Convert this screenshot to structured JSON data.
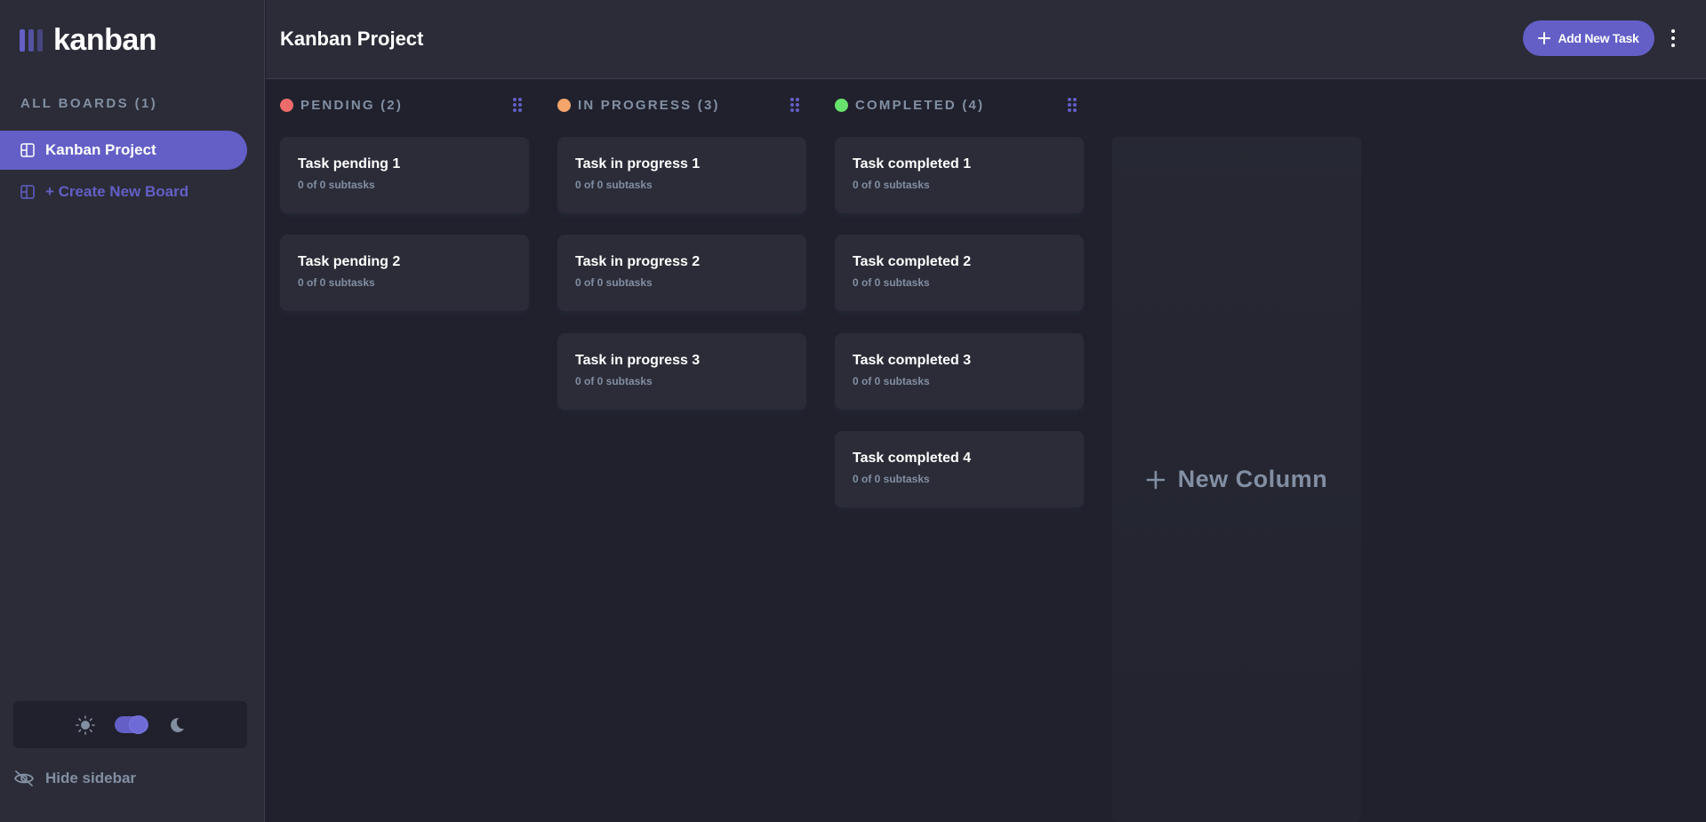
{
  "app": {
    "logo_text": "kanban"
  },
  "sidebar": {
    "all_boards_label": "ALL BOARDS (1)",
    "boards": [
      {
        "label": "Kanban Project",
        "active": true
      }
    ],
    "create_board_label": "+ Create New Board",
    "hide_sidebar_label": "Hide sidebar",
    "theme": "dark"
  },
  "header": {
    "title": "Kanban Project",
    "add_task_label": "Add New Task"
  },
  "columns": [
    {
      "title": "PENDING (2)",
      "color": "#f16b6b",
      "tasks": [
        {
          "title": "Task pending 1",
          "subtasks": "0 of 0 subtasks"
        },
        {
          "title": "Task pending 2",
          "subtasks": "0 of 0 subtasks"
        }
      ]
    },
    {
      "title": "IN PROGRESS (3)",
      "color": "#f4a56b",
      "tasks": [
        {
          "title": "Task in progress 1",
          "subtasks": "0 of 0 subtasks"
        },
        {
          "title": "Task in progress 2",
          "subtasks": "0 of 0 subtasks"
        },
        {
          "title": "Task in progress 3",
          "subtasks": "0 of 0 subtasks"
        }
      ]
    },
    {
      "title": "COMPLETED (4)",
      "color": "#67e26c",
      "tasks": [
        {
          "title": "Task completed 1",
          "subtasks": "0 of 0 subtasks"
        },
        {
          "title": "Task completed 2",
          "subtasks": "0 of 0 subtasks"
        },
        {
          "title": "Task completed 3",
          "subtasks": "0 of 0 subtasks"
        },
        {
          "title": "Task completed 4",
          "subtasks": "0 of 0 subtasks"
        }
      ]
    }
  ],
  "new_column_label": "New Column",
  "colors": {
    "accent": "#635fc7",
    "background": "#20212c",
    "surface": "#2b2c37",
    "muted_text": "#828fa3"
  }
}
